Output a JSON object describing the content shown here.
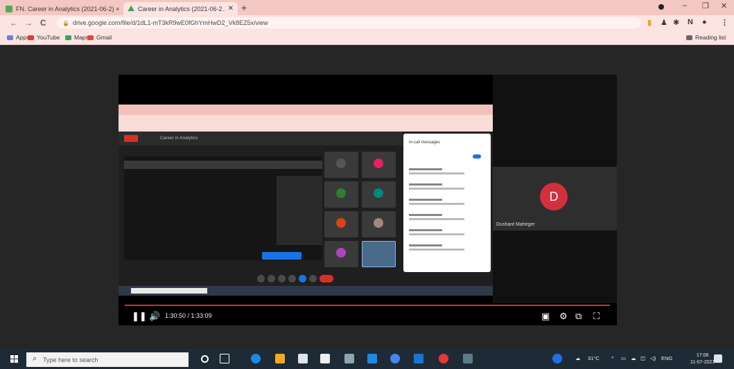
{
  "browser": {
    "tabs": [
      {
        "title": "FN. Career in Analytics (2021-06-2) ×",
        "active": false
      },
      {
        "title": "Career in Analytics (2021-06-2…",
        "active": true
      }
    ],
    "new_tab_label": "+",
    "window_controls": {
      "minimize": "–",
      "restore": "❐",
      "close": "✕"
    },
    "nav": {
      "back": "←",
      "forward": "→",
      "reload": "C"
    },
    "url": "drive.google.com/file/d/1dL1-mT3kR9wE0fGhYmHwD2_Vk8EZ5x/view",
    "bookmarks": [
      {
        "label": "Apps",
        "color": "#6b7fd7"
      },
      {
        "label": "YouTube",
        "color": "#e53935"
      },
      {
        "label": "Maps",
        "color": "#34a853"
      },
      {
        "label": "Gmail",
        "color": "#ea4335"
      }
    ],
    "reading_list": "Reading list"
  },
  "player": {
    "time": "1:30:50 / 1:33:09",
    "participant": {
      "initial": "D",
      "name": "Dushant Maheger"
    },
    "shared_screen": {
      "meeting_title": "Career in Analytics",
      "chat_title": "In-call messages"
    }
  },
  "taskbar": {
    "search_placeholder": "Type here to search",
    "weather": "31°C",
    "language": "ENG",
    "clock_time": "17:06",
    "clock_date": "11-07-2021",
    "colors": {
      "background": "#1e2b36",
      "accent": "#1a73e8"
    }
  }
}
